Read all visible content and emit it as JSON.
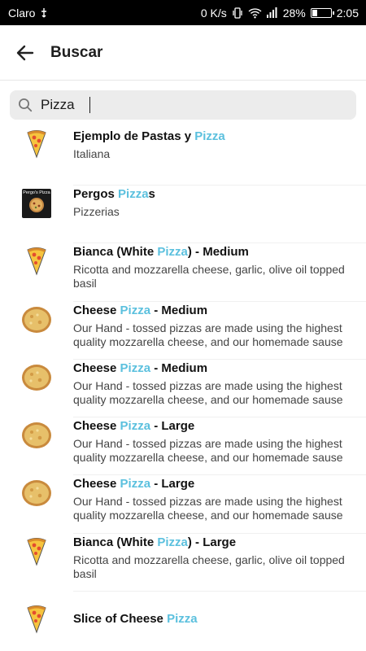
{
  "status_bar": {
    "carrier": "Claro",
    "net_speed": "0 K/s",
    "battery": "28%",
    "time": "2:05"
  },
  "app_bar": {
    "title": "Buscar",
    "back_icon": "arrow-left-icon"
  },
  "search": {
    "value": "Pizza",
    "icon": "search-icon"
  },
  "colors": {
    "highlight": "#5bc0de"
  },
  "results": [
    {
      "pre": "Ejemplo de Pastas y ",
      "match": "Pizza",
      "post": "",
      "sub": "Italiana",
      "thumb": "pizza-slice-icon"
    },
    {
      "pre": "Pergos ",
      "match": "Pizza",
      "post": "s",
      "sub": "Pizzerias",
      "thumb": "restaurant-logo"
    },
    {
      "pre": "Bianca (White ",
      "match": "Pizza",
      "post": ") - Medium",
      "sub": "Ricotta and mozzarella cheese, garlic, olive oil topped basil",
      "thumb": "pizza-slice-icon"
    },
    {
      "pre": "Cheese ",
      "match": "Pizza",
      "post": " - Medium",
      "sub": "Our Hand - tossed pizzas are made using the highest quality mozzarella cheese, and our homemade sause",
      "thumb": "whole-pizza-image"
    },
    {
      "pre": "Cheese ",
      "match": "Pizza",
      "post": " - Medium",
      "sub": "Our Hand - tossed pizzas are made using the highest quality mozzarella cheese, and our homemade sause",
      "thumb": "whole-pizza-image"
    },
    {
      "pre": "Cheese ",
      "match": "Pizza",
      "post": " - Large",
      "sub": "Our Hand - tossed pizzas are made using the highest quality mozzarella cheese, and our homemade sause",
      "thumb": "whole-pizza-image"
    },
    {
      "pre": "Cheese ",
      "match": "Pizza",
      "post": " - Large",
      "sub": "Our Hand - tossed pizzas are made using the highest quality mozzarella cheese, and our homemade sause",
      "thumb": "whole-pizza-image"
    },
    {
      "pre": "Bianca (White ",
      "match": "Pizza",
      "post": ") - Large",
      "sub": "Ricotta and mozzarella cheese, garlic, olive oil topped basil",
      "thumb": "pizza-slice-icon"
    },
    {
      "pre": "Slice of Cheese ",
      "match": "Pizza",
      "post": "",
      "sub": "",
      "thumb": "pizza-slice-icon"
    }
  ],
  "logo_text": {
    "brand": "Pergo's Pizza"
  }
}
